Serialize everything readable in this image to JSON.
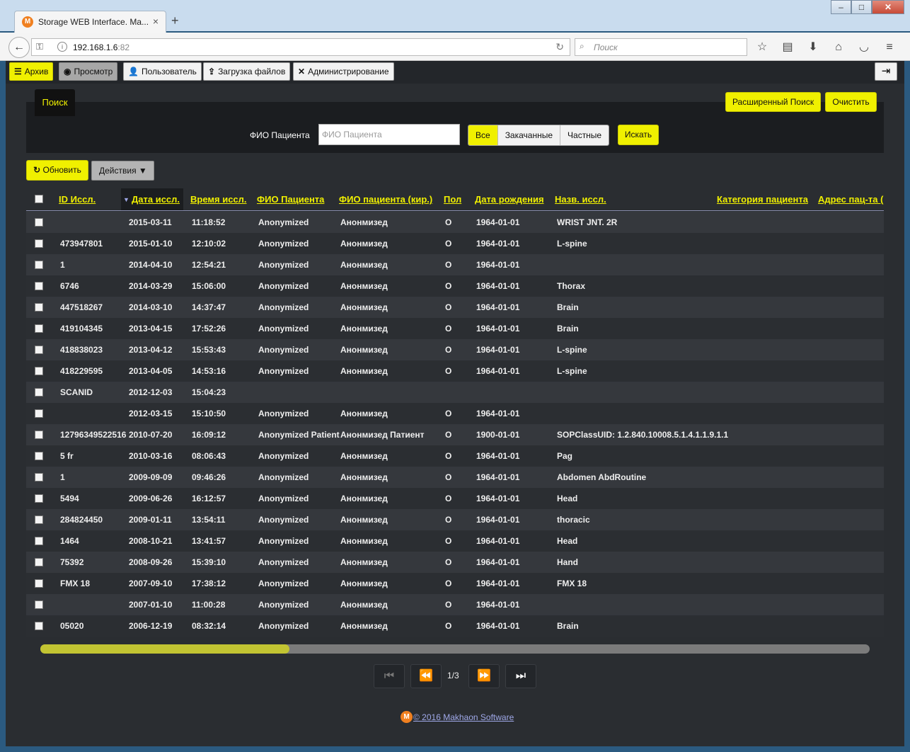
{
  "browser": {
    "tab_title": "Storage WEB Interface. Ma...",
    "tab_close": "×",
    "new_tab": "+",
    "url_host": "192.168.1.6",
    "url_port": ":82",
    "search_placeholder": "Поиск"
  },
  "menu": {
    "items": [
      {
        "label": "Архив",
        "icon": "list-icon"
      },
      {
        "label": "Просмотр",
        "icon": "eye-icon"
      },
      {
        "label": "Пользователь",
        "icon": "user-icon"
      },
      {
        "label": "Загрузка файлов",
        "icon": "upload-icon"
      },
      {
        "label": "Администрирование",
        "icon": "tools-icon"
      }
    ]
  },
  "search": {
    "tab_label": "Поиск",
    "advanced_label": "Расширенный Поиск",
    "clear_label": "Очистить",
    "fio_label": "ФИО Пациента",
    "fio_placeholder": "ФИО Пациента",
    "filters": [
      "Все",
      "Закачанные",
      "Частные"
    ],
    "selected_filter": "Все",
    "search_button": "Искать"
  },
  "toolbar": {
    "refresh_label": "Обновить",
    "actions_label": "Действия"
  },
  "table": {
    "sort_column": "Дата иссл.",
    "columns": [
      "ID Иссл.",
      "Дата иссл.",
      "Время иссл.",
      "ФИО Пациента",
      "ФИО пациента (кир.)",
      "Пол",
      "Дата рождения",
      "Назв. иссл.",
      "Категория пациента",
      "Адрес пац-та (Г"
    ],
    "rows": [
      [
        "",
        "2015-03-11",
        "11:18:52",
        "Anonymized",
        "Анонмизед",
        "O",
        "1964-01-01",
        "WRIST JNT. 2R"
      ],
      [
        "473947801",
        "2015-01-10",
        "12:10:02",
        "Anonymized",
        "Анонмизед",
        "O",
        "1964-01-01",
        "L-spine"
      ],
      [
        "1",
        "2014-04-10",
        "12:54:21",
        "Anonymized",
        "Анонмизед",
        "O",
        "1964-01-01",
        ""
      ],
      [
        "6746",
        "2014-03-29",
        "15:06:00",
        "Anonymized",
        "Анонмизед",
        "O",
        "1964-01-01",
        "Thorax"
      ],
      [
        "447518267",
        "2014-03-10",
        "14:37:47",
        "Anonymized",
        "Анонмизед",
        "O",
        "1964-01-01",
        "Brain"
      ],
      [
        "419104345",
        "2013-04-15",
        "17:52:26",
        "Anonymized",
        "Анонмизед",
        "O",
        "1964-01-01",
        "Brain"
      ],
      [
        "418838023",
        "2013-04-12",
        "15:53:43",
        "Anonymized",
        "Анонмизед",
        "O",
        "1964-01-01",
        "L-spine"
      ],
      [
        "418229595",
        "2013-04-05",
        "14:53:16",
        "Anonymized",
        "Анонмизед",
        "O",
        "1964-01-01",
        "L-spine"
      ],
      [
        "SCANID",
        "2012-12-03",
        "15:04:23",
        "",
        "",
        "",
        "",
        ""
      ],
      [
        "",
        "2012-03-15",
        "15:10:50",
        "Anonymized",
        "Анонмизед",
        "O",
        "1964-01-01",
        ""
      ],
      [
        "12796349522516",
        "2010-07-20",
        "16:09:12",
        "Anonymized Patient",
        "Анонмизед Патиент",
        "O",
        "1900-01-01",
        "SOPClassUID: 1.2.840.10008.5.1.4.1.1.9.1.1"
      ],
      [
        "5 fr",
        "2010-03-16",
        "08:06:43",
        "Anonymized",
        "Анонмизед",
        "O",
        "1964-01-01",
        "Pag"
      ],
      [
        "1",
        "2009-09-09",
        "09:46:26",
        "Anonymized",
        "Анонмизед",
        "O",
        "1964-01-01",
        "Abdomen AbdRoutine"
      ],
      [
        "5494",
        "2009-06-26",
        "16:12:57",
        "Anonymized",
        "Анонмизед",
        "O",
        "1964-01-01",
        "Head"
      ],
      [
        "284824450",
        "2009-01-11",
        "13:54:11",
        "Anonymized",
        "Анонмизед",
        "O",
        "1964-01-01",
        "thoracic"
      ],
      [
        "1464",
        "2008-10-21",
        "13:41:57",
        "Anonymized",
        "Анонмизед",
        "O",
        "1964-01-01",
        "Head"
      ],
      [
        "75392",
        "2008-09-26",
        "15:39:10",
        "Anonymized",
        "Анонмизед",
        "O",
        "1964-01-01",
        "Hand"
      ],
      [
        "FMX 18",
        "2007-09-10",
        "17:38:12",
        "Anonymized",
        "Анонмизед",
        "O",
        "1964-01-01",
        "FMX 18"
      ],
      [
        "",
        "2007-01-10",
        "11:00:28",
        "Anonymized",
        "Анонмизед",
        "O",
        "1964-01-01",
        ""
      ],
      [
        "05020",
        "2006-12-19",
        "08:32:14",
        "Anonymized",
        "Анонмизед",
        "O",
        "1964-01-01",
        "Brain"
      ]
    ]
  },
  "scroll": {
    "horizontal_position_fraction": 0.3
  },
  "pagination": {
    "page_info": "1/3"
  },
  "footer": {
    "text": "© 2016 Makhaon Software"
  },
  "colors": {
    "accent": "#f0f000",
    "background": "#2a2d31",
    "link": "#9fa8e8"
  }
}
